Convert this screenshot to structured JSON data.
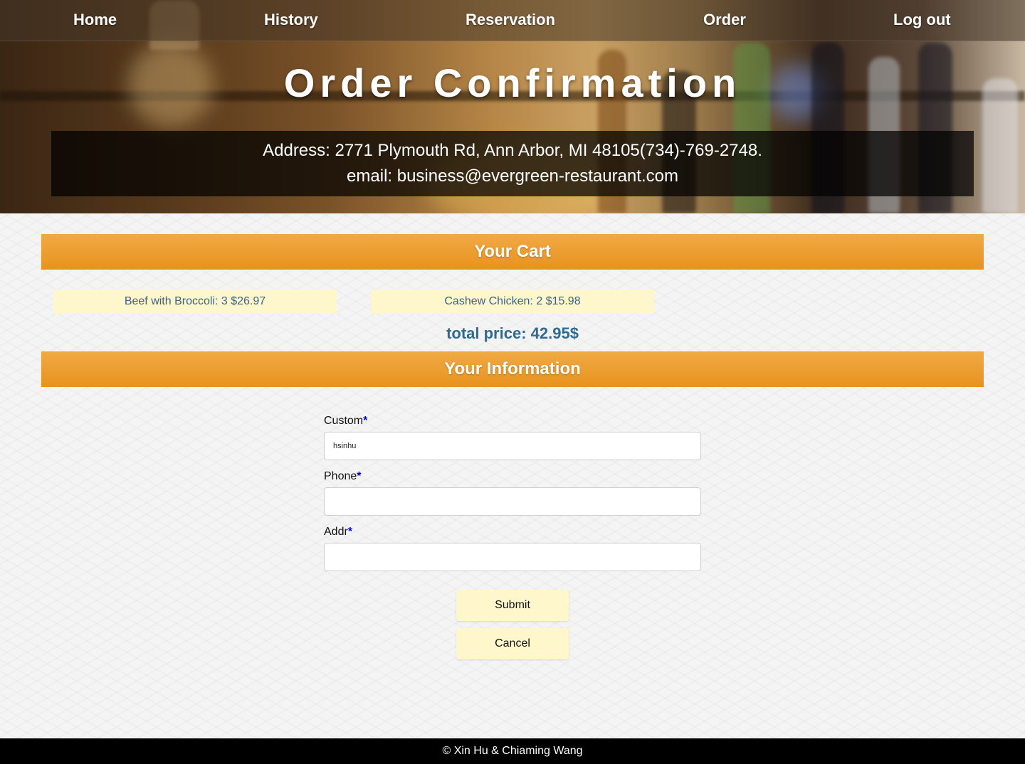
{
  "nav": {
    "home": "Home",
    "history": "History",
    "reservation": "Reservation",
    "order": "Order",
    "logout": "Log out"
  },
  "header": {
    "title": "Order Confirmation",
    "address": "Address: 2771 Plymouth Rd, Ann Arbor, MI 48105(734)-769-2748.",
    "email": "email: business@evergreen-restaurant.com"
  },
  "cart": {
    "heading": "Your Cart",
    "items": [
      "Beef with Broccoli: 3 $26.97",
      "Cashew Chicken: 2 $15.98"
    ],
    "total": "total price: 42.95$"
  },
  "info": {
    "heading": "Your Information",
    "fields": [
      {
        "label": "Custom",
        "required": "*",
        "value": "hsinhu",
        "placeholder": ""
      },
      {
        "label": "Phone",
        "required": "*",
        "value": "",
        "placeholder": ""
      },
      {
        "label": "Addr",
        "required": "*",
        "value": "",
        "placeholder": ""
      }
    ],
    "submit_label": "Submit",
    "cancel_label": "Cancel"
  },
  "footer": {
    "text": "© Xin Hu & Chiaming Wang"
  },
  "colors": {
    "section_bar": "#e8921e",
    "cart_item_bg": "#fdf7cb",
    "cart_item_text": "#3a6290",
    "total_text": "#2f6a91",
    "required_star": "#0000cc",
    "footer_bg": "#000000"
  }
}
